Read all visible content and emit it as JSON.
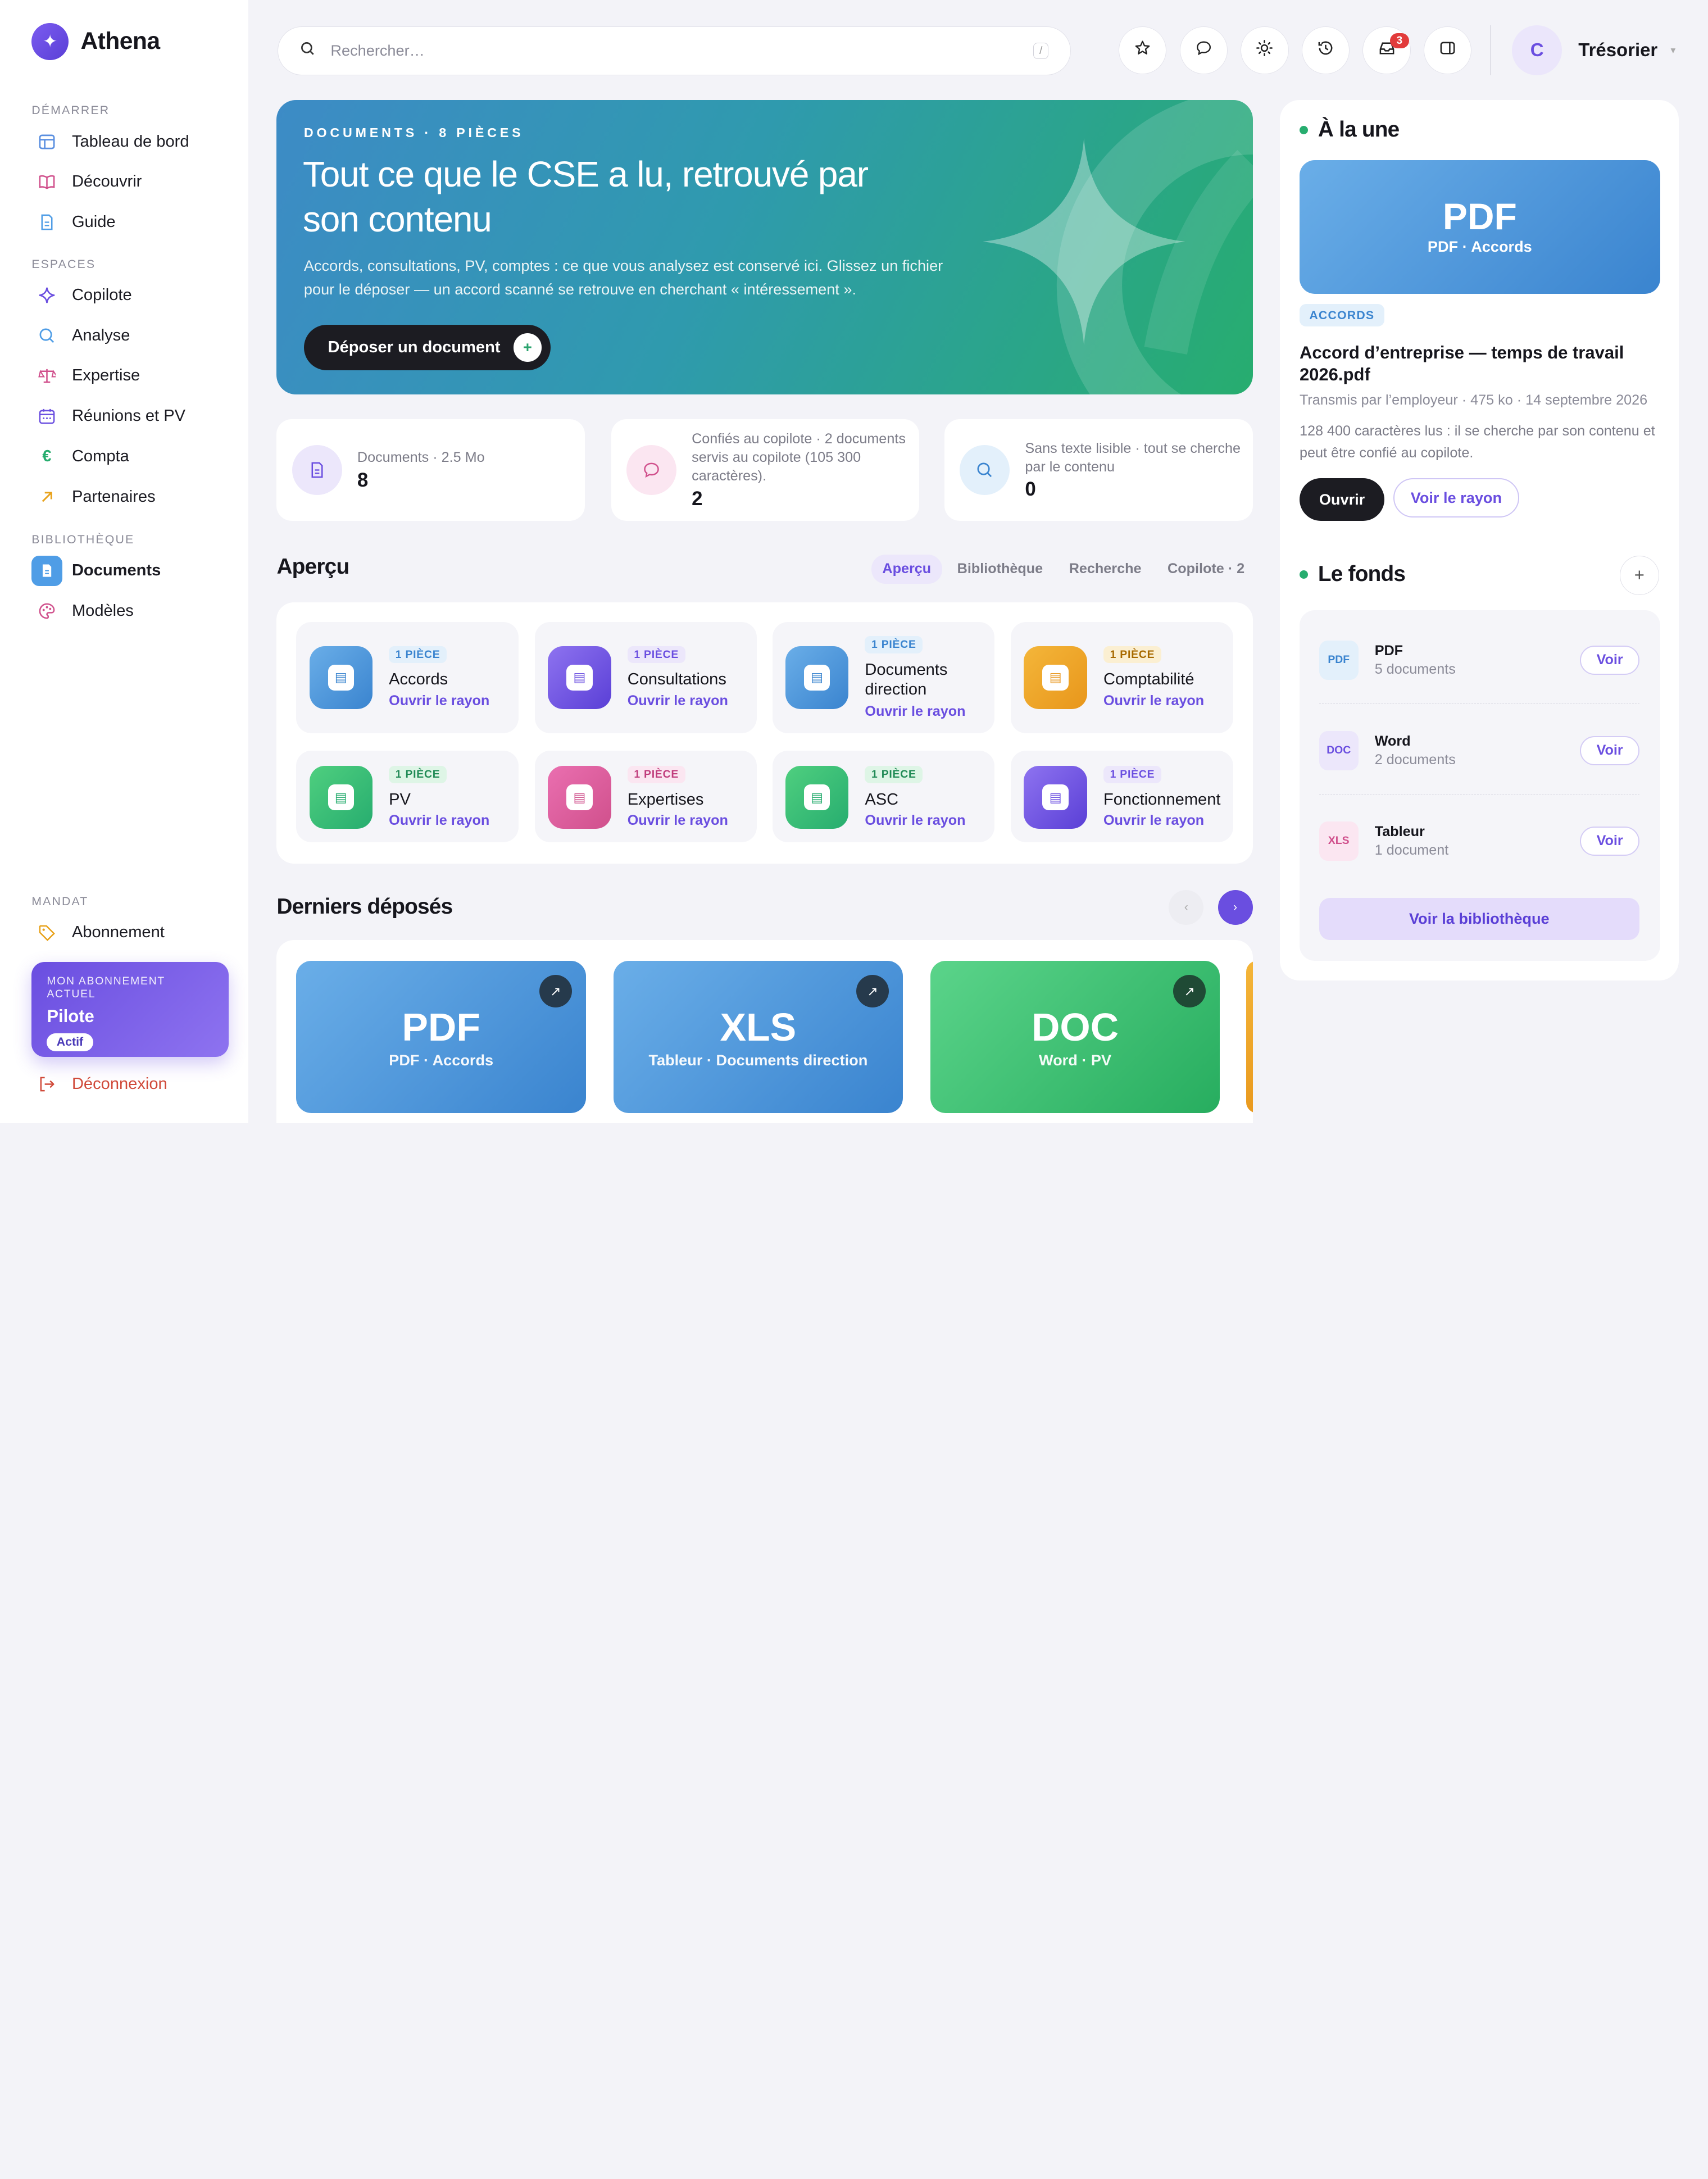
{
  "app": {
    "name": "Athena"
  },
  "sidebar": {
    "sections": [
      {
        "label": "DÉMARRER"
      },
      {
        "label": "ESPACES"
      },
      {
        "label": "BIBLIOTHÈQUE"
      },
      {
        "label": "MANDAT"
      }
    ],
    "items": [
      {
        "label": "Tableau de bord",
        "icon": "layout-icon"
      },
      {
        "label": "Découvrir",
        "icon": "book-open-icon"
      },
      {
        "label": "Guide",
        "icon": "file-icon"
      },
      {
        "label": "Copilote",
        "icon": "sparkle-icon"
      },
      {
        "label": "Analyse",
        "icon": "search-icon"
      },
      {
        "label": "Expertise",
        "icon": "scale-icon"
      },
      {
        "label": "Réunions et PV",
        "icon": "calendar-icon"
      },
      {
        "label": "Compta",
        "icon": "euro-icon"
      },
      {
        "label": "Partenaires",
        "icon": "arrow-up-right-icon"
      },
      {
        "label": "Documents",
        "icon": "document-icon",
        "active": true
      },
      {
        "label": "Modèles",
        "icon": "palette-icon"
      },
      {
        "label": "Abonnement",
        "icon": "tag-icon"
      }
    ],
    "subscription": {
      "kicker": "MON ABONNEMENT ACTUEL",
      "plan": "Pilote",
      "status": "Actif"
    },
    "logout": "Déconnexion"
  },
  "topbar": {
    "search_placeholder": "Rechercher…",
    "search_shortcut": "/",
    "notification_count": "3",
    "user_initial": "C",
    "user_name": "Trésorier"
  },
  "hero": {
    "eyebrow": "DOCUMENTS · 8 PIÈCES",
    "title": "Tout ce que le CSE a lu, retrouvé par son contenu",
    "description": "Accords, consultations, PV, comptes : ce que vous analysez est conservé ici. Glissez un fichier pour le déposer — un accord scanné se retrouve en cherchant « intéressement ».",
    "button": "Déposer un document"
  },
  "stats": [
    {
      "label": "Documents · 2.5 Mo",
      "value": "8"
    },
    {
      "label": "Confiés au copilote · 2 documents servis au copilote (105 300 caractères).",
      "value": "2"
    },
    {
      "label": "Sans texte lisible · tout se cherche par le contenu",
      "value": "0"
    }
  ],
  "overview": {
    "title": "Aperçu",
    "tabs": [
      "Aperçu",
      "Bibliothèque",
      "Recherche",
      "Copilote · 2"
    ],
    "categories": [
      {
        "badge": "1 PIÈCE",
        "name": "Accords",
        "link": "Ouvrir le rayon"
      },
      {
        "badge": "1 PIÈCE",
        "name": "Consultations",
        "link": "Ouvrir le rayon"
      },
      {
        "badge": "1 PIÈCE",
        "name": "Documents direction",
        "link": "Ouvrir le rayon"
      },
      {
        "badge": "1 PIÈCE",
        "name": "Comptabilité",
        "link": "Ouvrir le rayon"
      },
      {
        "badge": "1 PIÈCE",
        "name": "PV",
        "link": "Ouvrir le rayon"
      },
      {
        "badge": "1 PIÈCE",
        "name": "Expertises",
        "link": "Ouvrir le rayon"
      },
      {
        "badge": "1 PIÈCE",
        "name": "ASC",
        "link": "Ouvrir le rayon"
      },
      {
        "badge": "1 PIÈCE",
        "name": "Fonctionnement",
        "link": "Ouvrir le rayon"
      }
    ]
  },
  "recent": {
    "title": "Derniers déposés",
    "prev": "‹",
    "next": "›",
    "cards": [
      {
        "type": "PDF",
        "sub": "PDF · Accords"
      },
      {
        "type": "XLS",
        "sub": "Tableur · Documents direction"
      },
      {
        "type": "DOC",
        "sub": "Word · PV"
      }
    ]
  },
  "featured": {
    "title": "À la une",
    "card_type": "PDF",
    "card_sub": "PDF · Accords",
    "tag": "ACCORDS",
    "doc_title": "Accord d’entreprise — temps de travail 2026.pdf",
    "meta": "Transmis par l’employeur · 475 ko · 14 septembre 2026",
    "description": "128 400 caractères lus : il se cherche par son contenu et peut être confié au copilote.",
    "open": "Ouvrir",
    "shelf": "Voir le rayon"
  },
  "fund": {
    "title": "Le fonds",
    "rows": [
      {
        "tag": "PDF",
        "name": "PDF",
        "count": "5 documents",
        "action": "Voir"
      },
      {
        "tag": "DOC",
        "name": "Word",
        "count": "2 documents",
        "action": "Voir"
      },
      {
        "tag": "XLS",
        "name": "Tableur",
        "count": "1 document",
        "action": "Voir"
      }
    ],
    "library_button": "Voir la bibliothèque"
  }
}
